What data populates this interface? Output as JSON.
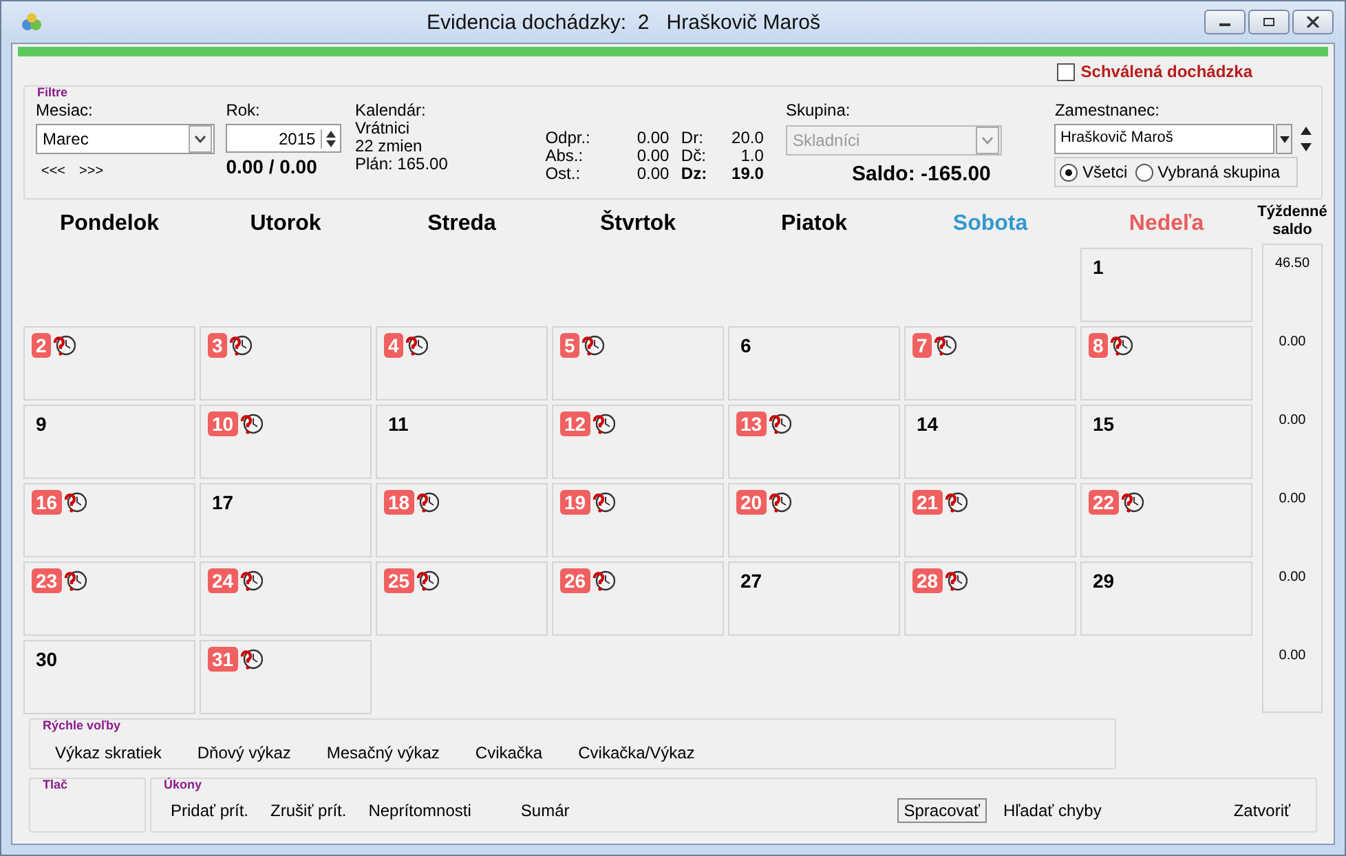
{
  "window": {
    "title": "Evidencia dochádzky:  2   Hraškovič Maroš"
  },
  "approved": {
    "label": "Schválená dochádzka",
    "checked": false
  },
  "filter": {
    "title": "Filtre",
    "month_label": "Mesiac:",
    "month": "Marec",
    "prev": "<<<",
    "next": ">>>",
    "year_label": "Rok:",
    "year": "2015",
    "ratio": "0.00 / 0.00",
    "calendar_label": "Kalendár:",
    "calendar_lines": [
      "Vrátnici",
      "22 zmien",
      "Plán: 165.00"
    ],
    "stats_left": [
      {
        "label": "Odpr.:",
        "value": "0.00"
      },
      {
        "label": "Abs.:",
        "value": "0.00"
      },
      {
        "label": "Ost.:",
        "value": "0.00"
      }
    ],
    "stats_right": [
      {
        "label": "Dr:",
        "value": "20.0",
        "bold": false
      },
      {
        "label": "Dč:",
        "value": "1.0",
        "bold": false
      },
      {
        "label": "Dz:",
        "value": "19.0",
        "bold": true
      }
    ],
    "group_label": "Skupina:",
    "group": "Skladníci",
    "group_disabled": true,
    "saldo": "Saldo: -165.00",
    "employee_label": "Zamestnanec:",
    "employee": "Hraškovič Maroš",
    "scope": [
      {
        "label": "Všetci",
        "selected": true
      },
      {
        "label": "Vybraná skupina",
        "selected": false
      }
    ]
  },
  "weekdays": [
    {
      "label": "Pondelok",
      "color": "#000000"
    },
    {
      "label": "Utorok",
      "color": "#000000"
    },
    {
      "label": "Streda",
      "color": "#000000"
    },
    {
      "label": "Štvrtok",
      "color": "#000000"
    },
    {
      "label": "Piatok",
      "color": "#000000"
    },
    {
      "label": "Sobota",
      "color": "#3399cc"
    },
    {
      "label": "Nedeľa",
      "color": "#e85c5c"
    }
  ],
  "weekly_label": "Týždenné saldo",
  "weeks": [
    {
      "saldo": "46.50",
      "days": [
        {
          "day": "1",
          "flagged": false
        }
      ]
    },
    {
      "saldo": "0.00",
      "days": [
        {
          "day": "2",
          "flagged": true
        },
        {
          "day": "3",
          "flagged": true
        },
        {
          "day": "4",
          "flagged": true
        },
        {
          "day": "5",
          "flagged": true
        },
        {
          "day": "6",
          "flagged": false
        },
        {
          "day": "7",
          "flagged": true
        },
        {
          "day": "8",
          "flagged": true
        }
      ]
    },
    {
      "saldo": "0.00",
      "days": [
        {
          "day": "9",
          "flagged": false
        },
        {
          "day": "10",
          "flagged": true
        },
        {
          "day": "11",
          "flagged": false
        },
        {
          "day": "12",
          "flagged": true
        },
        {
          "day": "13",
          "flagged": true
        },
        {
          "day": "14",
          "flagged": false
        },
        {
          "day": "15",
          "flagged": false
        }
      ]
    },
    {
      "saldo": "0.00",
      "days": [
        {
          "day": "16",
          "flagged": true
        },
        {
          "day": "17",
          "flagged": false
        },
        {
          "day": "18",
          "flagged": true
        },
        {
          "day": "19",
          "flagged": true
        },
        {
          "day": "20",
          "flagged": true
        },
        {
          "day": "21",
          "flagged": true
        },
        {
          "day": "22",
          "flagged": true
        }
      ]
    },
    {
      "saldo": "0.00",
      "days": [
        {
          "day": "23",
          "flagged": true
        },
        {
          "day": "24",
          "flagged": true
        },
        {
          "day": "25",
          "flagged": true
        },
        {
          "day": "26",
          "flagged": true
        },
        {
          "day": "27",
          "flagged": false
        },
        {
          "day": "28",
          "flagged": true
        },
        {
          "day": "29",
          "flagged": false
        }
      ]
    },
    {
      "saldo": "0.00",
      "days": [
        {
          "day": "30",
          "flagged": false
        },
        {
          "day": "31",
          "flagged": true
        }
      ]
    }
  ],
  "quick": {
    "title": "Rýchle voľby",
    "buttons": [
      "Výkaz skratiek",
      "Dňový výkaz",
      "Mesačný výkaz",
      "Cvikačka",
      "Cvikačka/Výkaz"
    ]
  },
  "print": {
    "title": "Tlač"
  },
  "actions": {
    "title": "Úkony",
    "buttons": [
      {
        "label": "Pridať prít.",
        "kind": "flat"
      },
      {
        "label": "Zrušiť prít.",
        "kind": "flat"
      },
      {
        "label": "Neprítomnosti",
        "kind": "flat"
      },
      {
        "label": "Sumár",
        "kind": "flat"
      },
      {
        "label": "Spracovať",
        "kind": "default"
      },
      {
        "label": "Hľadať chyby",
        "kind": "flat"
      },
      {
        "label": "Zatvoriť",
        "kind": "flat"
      }
    ]
  }
}
